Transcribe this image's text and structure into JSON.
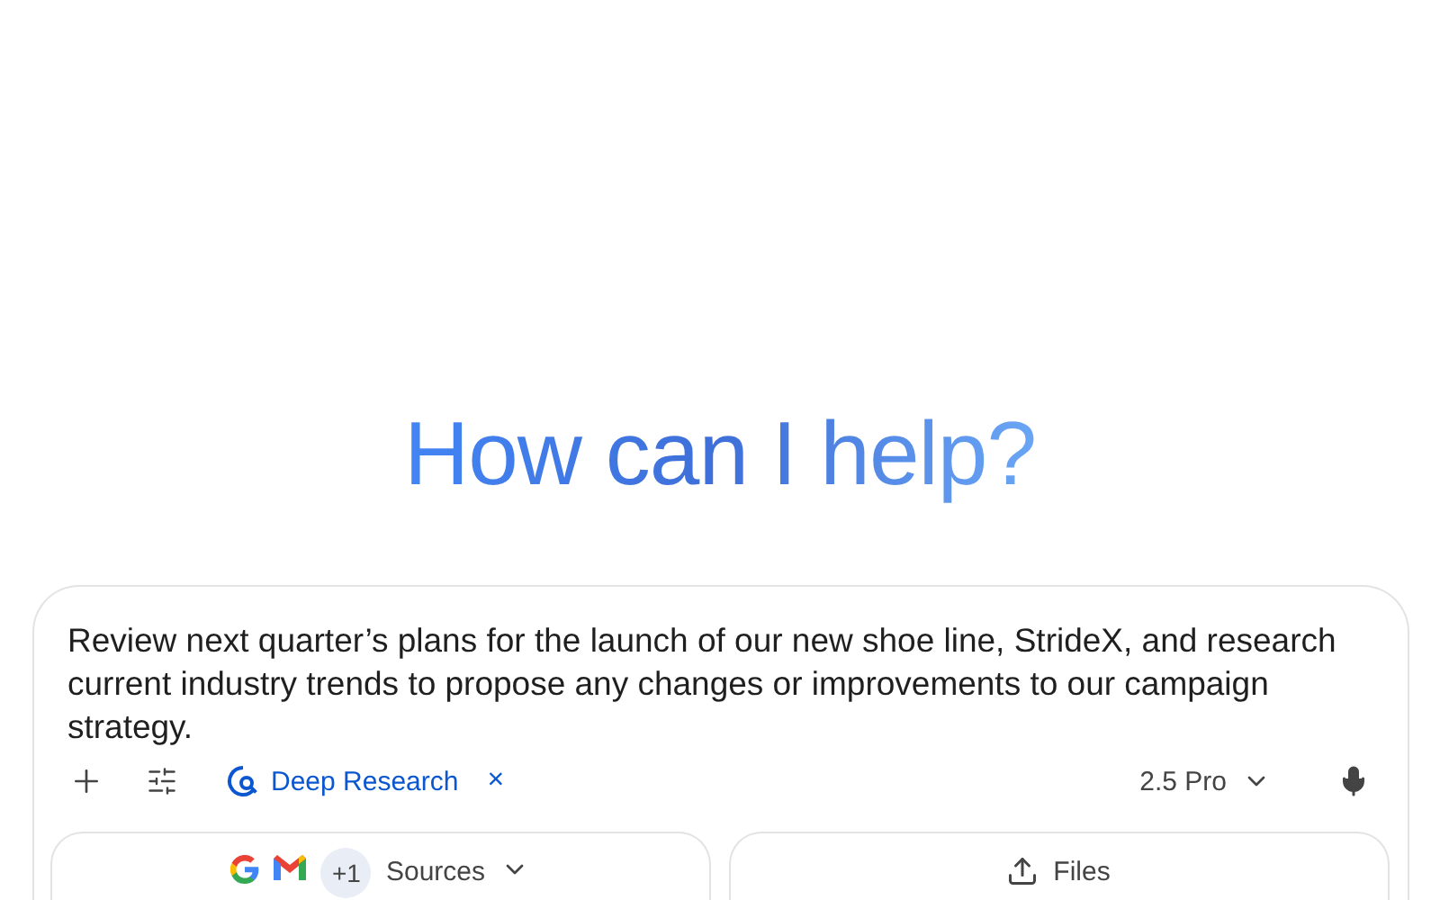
{
  "heading": "How can I help?",
  "prompt": {
    "value": "Review next quarter’s plans for the launch of our new shoe line, StrideX, and research current industry trends to propose any changes or improvements to our campaign strategy."
  },
  "tool_chip": {
    "label": "Deep Research",
    "remove": "×"
  },
  "model": {
    "label": "2.5 Pro"
  },
  "sources": {
    "extra_count": "+1",
    "label": "Sources"
  },
  "files": {
    "label": "Files"
  }
}
